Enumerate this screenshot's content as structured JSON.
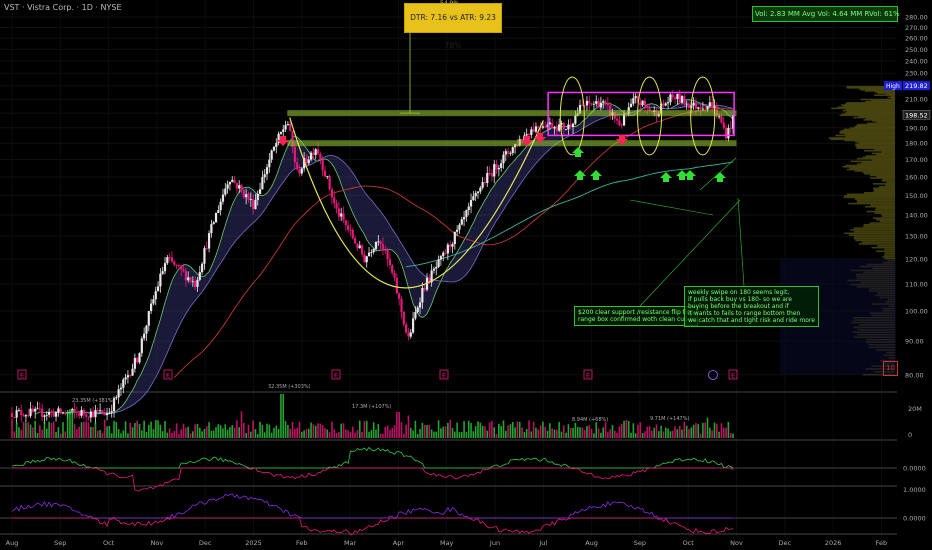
{
  "header": {
    "title": "VST · Vistra Corp. · 1D · NYSE"
  },
  "volume_box": {
    "text": "Vol: 2.83 MM   Avg Vol: 4.64 MM   RVol: 61%"
  },
  "dtr_box": {
    "top_label": "54.9%",
    "text": "DTR: 7.16 vs ATR: 9.23 78%"
  },
  "annotations": {
    "left": [
      "$200 clear  support /resistance flip flop",
      "range box confirmed woth clean cup n"
    ],
    "right": [
      "weekly swipe on 180 seems legit,",
      "if pulls back buy vs 180- so we are",
      "buying before the breakout and if",
      "it wants to fails to range bottom then",
      "we catch that and tight risk and ride more"
    ]
  },
  "badge": {
    "text": "10"
  },
  "colors": {
    "up": "#2ecc40",
    "down": "#e6197a",
    "zone": "#9acd32",
    "box": "#ff33ff",
    "cup": "#e5e55a",
    "high_tag": "#1f1fd6",
    "ma_slow": "#c0392b",
    "ma_long": "#3bb3a0"
  },
  "chart_data": [
    {
      "type": "candlestick",
      "title": "",
      "x_labels": [
        "Aug",
        "Sep",
        "Oct",
        "Nov",
        "Dec",
        "2025",
        "Feb",
        "Mar",
        "Apr",
        "May",
        "Jun",
        "Jul",
        "Aug",
        "Sep",
        "Oct",
        "Nov",
        "Dec",
        "2026",
        "Feb"
      ],
      "y_ticks": [
        80,
        90,
        100,
        110,
        120,
        130,
        140,
        150,
        160,
        170,
        180,
        190,
        200,
        210,
        220,
        230,
        240,
        250,
        260,
        270,
        280
      ],
      "ylim": [
        78,
        285
      ],
      "log_scale": true,
      "price_path": [
        [
          0,
          70
        ],
        [
          2,
          70
        ],
        [
          2.6,
          85
        ],
        [
          3.2,
          120
        ],
        [
          3.8,
          110
        ],
        [
          4.5,
          160
        ],
        [
          5.0,
          145
        ],
        [
          5.4,
          175
        ],
        [
          5.7,
          195
        ],
        [
          5.9,
          162
        ],
        [
          6.3,
          178
        ],
        [
          6.7,
          143
        ],
        [
          7.3,
          120
        ],
        [
          7.6,
          130
        ],
        [
          7.9,
          112
        ],
        [
          8.2,
          90
        ],
        [
          8.5,
          108
        ],
        [
          8.9,
          120
        ],
        [
          9.3,
          135
        ],
        [
          9.7,
          155
        ],
        [
          10.2,
          172
        ],
        [
          10.7,
          188
        ],
        [
          11.0,
          193
        ],
        [
          11.5,
          190
        ],
        [
          11.8,
          205
        ],
        [
          12.2,
          208
        ],
        [
          12.6,
          192
        ],
        [
          12.9,
          210
        ],
        [
          13.3,
          200
        ],
        [
          13.7,
          212
        ],
        [
          14.1,
          205
        ],
        [
          14.5,
          206
        ],
        [
          14.8,
          185
        ],
        [
          14.95,
          198.52
        ]
      ],
      "last_price": 198.52,
      "high": {
        "label": "High",
        "value": 219.82
      },
      "levels": [
        200,
        180
      ],
      "range_box": {
        "x_start": 11.1,
        "x_end": 14.95,
        "low": 185,
        "high": 215
      },
      "moving_averages": [
        "fast EMA ribbon",
        "slow MA",
        "long MA"
      ],
      "earnings_markers": [
        "E",
        "E",
        "E",
        "E",
        "E",
        "E"
      ],
      "down_arrows": 4,
      "up_arrows": 7
    },
    {
      "type": "bar",
      "title": "Volume",
      "y_ticks": [
        "20M",
        "0"
      ],
      "labels": [
        "23.35M (+381%)",
        "32.35M (+303%)",
        "17.3M (+107%)",
        "8.94M (+68%)",
        "9.71M (+147%)"
      ]
    },
    {
      "type": "line",
      "title": "",
      "y_ticks": [
        "0.0000"
      ]
    },
    {
      "type": "line",
      "title": "",
      "y_ticks": [
        "1.0000",
        "0.0000"
      ]
    }
  ]
}
